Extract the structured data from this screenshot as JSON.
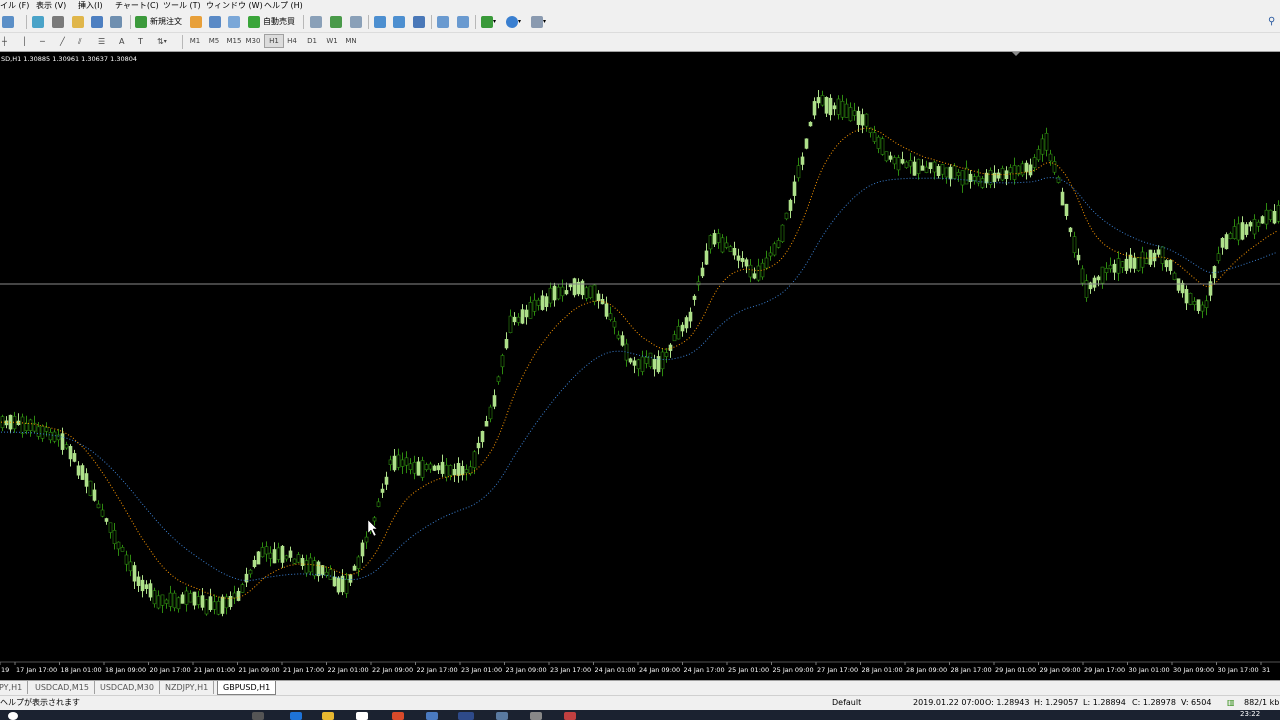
{
  "menu": [
    "イル (F)",
    "表示 (V)",
    "挿入(I)",
    "チャート(C)",
    "ツール (T)",
    "ウィンドウ (W)",
    "ヘルプ (H)"
  ],
  "toolbar": {
    "new_order_label": "新規注文",
    "autotrade_label": "自動売買"
  },
  "timeframes": [
    "M1",
    "M5",
    "M15",
    "M30",
    "H1",
    "H4",
    "D1",
    "W1",
    "MN"
  ],
  "active_timeframe": "H1",
  "chart": {
    "header": "SD,H1  1.30885 1.30961 1.30637 1.30804",
    "date_labels": [
      "19",
      "17 Jan 17:00",
      "18 Jan 01:00",
      "18 Jan 09:00",
      "20 Jan 17:00",
      "21 Jan 01:00",
      "21 Jan 09:00",
      "21 Jan 17:00",
      "22 Jan 01:00",
      "22 Jan 09:00",
      "22 Jan 17:00",
      "23 Jan 01:00",
      "23 Jan 09:00",
      "23 Jan 17:00",
      "24 Jan 01:00",
      "24 Jan 09:00",
      "24 Jan 17:00",
      "25 Jan 01:00",
      "25 Jan 09:00",
      "27 Jan 17:00",
      "28 Jan 01:00",
      "28 Jan 09:00",
      "28 Jan 17:00",
      "29 Jan 01:00",
      "29 Jan 09:00",
      "29 Jan 17:00",
      "30 Jan 01:00",
      "30 Jan 09:00",
      "30 Jan 17:00",
      "31"
    ],
    "colors": {
      "background": "#000000",
      "bull": "#aee08a",
      "bear": "#2e8b10",
      "ma_fast": "#ff9900",
      "ma_slow": "#3a7fd0",
      "hline": "#8a8a8a"
    }
  },
  "tabs": [
    "PY,H1",
    "USDCAD,M15",
    "USDCAD,M30",
    "NZDJPY,H1",
    "GBPUSD,H1"
  ],
  "active_tab": "GBPUSD,H1",
  "status": {
    "help": "ヘルプが表示されます",
    "profile": "Default",
    "datetime": "2019.01.22 07:00",
    "open": "O: 1.28943",
    "high": "H: 1.29057",
    "low": "L: 1.28894",
    "close": "C: 1.28978",
    "volume": "V: 6504",
    "traffic": "882/1 kb",
    "clock": "23:22"
  }
}
